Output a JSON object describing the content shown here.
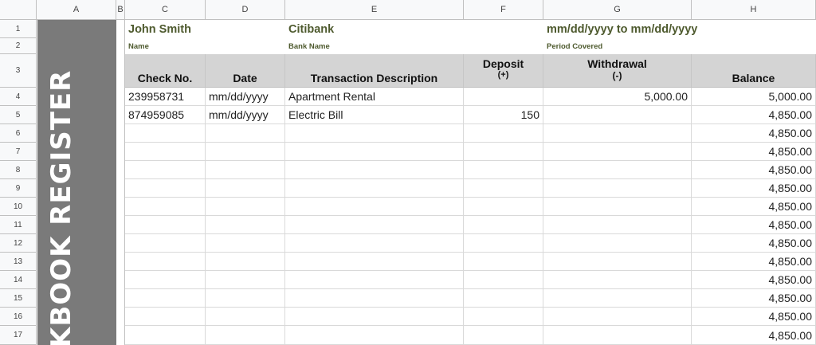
{
  "columns": [
    "A",
    "B",
    "C",
    "D",
    "E",
    "F",
    "G",
    "H"
  ],
  "rows": [
    "1",
    "2",
    "3",
    "4",
    "5",
    "6",
    "7",
    "8",
    "9",
    "10",
    "11",
    "12",
    "13",
    "14",
    "15",
    "16",
    "17"
  ],
  "sidebar_title": "KBOOK REGISTER",
  "info": {
    "name_value": "John Smith",
    "name_label": "Name",
    "bank_value": "Citibank",
    "bank_label": "Bank Name",
    "period_value": "mm/dd/yyyy to mm/dd/yyyy",
    "period_label": "Period Covered"
  },
  "headers": {
    "check_no": "Check No.",
    "date": "Date",
    "description": "Transaction Description",
    "deposit_line1": "Deposit",
    "deposit_line2": "(+)",
    "withdrawal_line1": "Withdrawal",
    "withdrawal_line2": "(-)",
    "balance": "Balance"
  },
  "transactions": [
    {
      "check_no": "239958731",
      "date": "mm/dd/yyyy",
      "description": "Apartment Rental",
      "deposit": "",
      "withdrawal": "5,000.00",
      "balance": "5,000.00"
    },
    {
      "check_no": "874959085",
      "date": "mm/dd/yyyy",
      "description": "Electric Bill",
      "deposit": "150",
      "withdrawal": "",
      "balance": "4,850.00"
    },
    {
      "check_no": "",
      "date": "",
      "description": "",
      "deposit": "",
      "withdrawal": "",
      "balance": "4,850.00"
    },
    {
      "check_no": "",
      "date": "",
      "description": "",
      "deposit": "",
      "withdrawal": "",
      "balance": "4,850.00"
    },
    {
      "check_no": "",
      "date": "",
      "description": "",
      "deposit": "",
      "withdrawal": "",
      "balance": "4,850.00"
    },
    {
      "check_no": "",
      "date": "",
      "description": "",
      "deposit": "",
      "withdrawal": "",
      "balance": "4,850.00"
    },
    {
      "check_no": "",
      "date": "",
      "description": "",
      "deposit": "",
      "withdrawal": "",
      "balance": "4,850.00"
    },
    {
      "check_no": "",
      "date": "",
      "description": "",
      "deposit": "",
      "withdrawal": "",
      "balance": "4,850.00"
    },
    {
      "check_no": "",
      "date": "",
      "description": "",
      "deposit": "",
      "withdrawal": "",
      "balance": "4,850.00"
    },
    {
      "check_no": "",
      "date": "",
      "description": "",
      "deposit": "",
      "withdrawal": "",
      "balance": "4,850.00"
    },
    {
      "check_no": "",
      "date": "",
      "description": "",
      "deposit": "",
      "withdrawal": "",
      "balance": "4,850.00"
    },
    {
      "check_no": "",
      "date": "",
      "description": "",
      "deposit": "",
      "withdrawal": "",
      "balance": "4,850.00"
    },
    {
      "check_no": "",
      "date": "",
      "description": "",
      "deposit": "",
      "withdrawal": "",
      "balance": "4,850.00"
    },
    {
      "check_no": "",
      "date": "",
      "description": "",
      "deposit": "",
      "withdrawal": "",
      "balance": "4,850.00"
    }
  ]
}
